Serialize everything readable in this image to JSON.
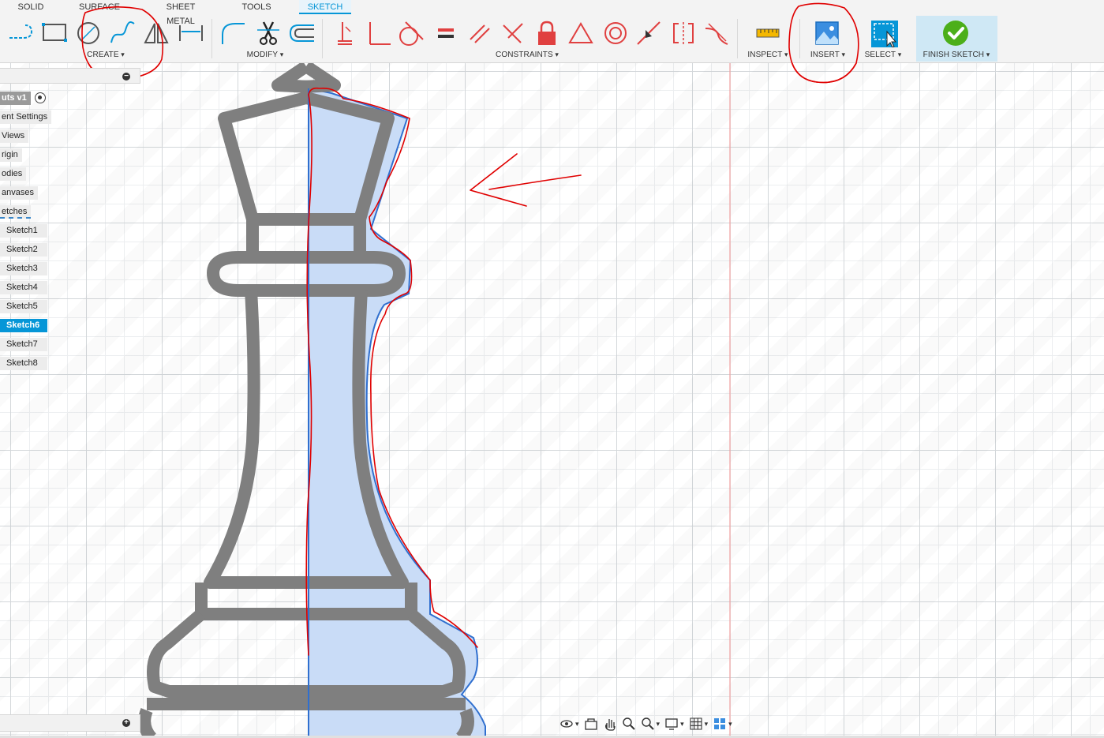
{
  "toolbar": {
    "tabs": [
      "SOLID",
      "SURFACE",
      "SHEET METAL",
      "TOOLS",
      "SKETCH"
    ],
    "active_tab": "SKETCH",
    "groups": {
      "create": "CREATE",
      "modify": "MODIFY",
      "constraints": "CONSTRAINTS",
      "inspect": "INSPECT",
      "insert": "INSERT",
      "select": "SELECT",
      "finish": "FINISH SKETCH"
    }
  },
  "browser": {
    "root": "uts v1",
    "items": [
      "ent Settings",
      "Views",
      "rigin",
      "odies",
      "anvases",
      "etches"
    ],
    "sketches": [
      "Sketch1",
      "Sketch2",
      "Sketch3",
      "Sketch4",
      "Sketch5",
      "Sketch6",
      "Sketch7",
      "Sketch8"
    ],
    "selected_sketch": "Sketch6"
  },
  "colors": {
    "accent": "#0696d7",
    "profile_fill": "#c9dcf7",
    "sketch_line": "#2f6fcf",
    "annotation": "#e00000",
    "shape_gray": "#7f7f7f",
    "finish_check": "#4caf1a"
  },
  "icons": {
    "navbar": [
      "orbit-icon",
      "look-at-icon",
      "pan-icon",
      "zoom-icon",
      "zoom-window-icon",
      "display-settings-icon",
      "grid-settings-icon",
      "viewports-icon"
    ]
  }
}
